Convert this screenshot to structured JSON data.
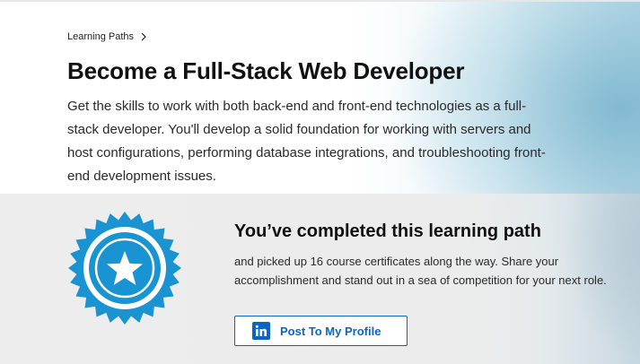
{
  "breadcrumb": {
    "label": "Learning Paths"
  },
  "header": {
    "title": "Become a Full-Stack Web Developer",
    "description": "Get the skills to work with both back-end and front-end technologies as a full-stack developer. You'll develop a solid foundation for working with servers and host configurations, performing database integrations, and troubleshooting front-end development issues."
  },
  "completion": {
    "title": "You’ve completed this learning path",
    "text": "and picked up 16 course certificates along the way. Share your accomplishment and stand out in a sea of competition for your next role.",
    "button_label": "Post To My Profile",
    "badge_icon": "star-badge-icon",
    "button_icon": "linkedin-icon"
  },
  "colors": {
    "accent": "#0a66c2",
    "badge": "#1a93d2",
    "panel_bg": "#ececec"
  }
}
